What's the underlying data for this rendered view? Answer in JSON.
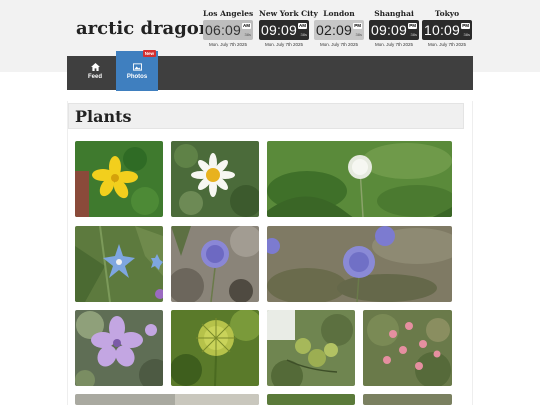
{
  "site": {
    "title": "arctic dragon"
  },
  "clocks": [
    {
      "city": "Los Angeles",
      "time": "06:09",
      "ampm": "AM",
      "seconds": "38s",
      "date": "Mon. July 7th 2025",
      "style": "light"
    },
    {
      "city": "New York City",
      "time": "09:09",
      "ampm": "AM",
      "seconds": "38s",
      "date": "Mon. July 7th 2025",
      "style": "dark"
    },
    {
      "city": "London",
      "time": "02:09",
      "ampm": "PM",
      "seconds": "38s",
      "date": "Mon. July 7th 2025",
      "style": "mid"
    },
    {
      "city": "Shanghai",
      "time": "09:09",
      "ampm": "PM",
      "seconds": "38s",
      "date": "Mon. July 7th 2025",
      "style": "dark"
    },
    {
      "city": "Tokyo",
      "time": "10:09",
      "ampm": "PM",
      "seconds": "38s",
      "date": "Mon. July 7th 2025",
      "style": "dark"
    }
  ],
  "nav": {
    "items": [
      {
        "label": "Feed",
        "icon": "home-icon",
        "active": false
      },
      {
        "label": "Photos",
        "icon": "image-icon",
        "active": true,
        "badge": "New"
      }
    ]
  },
  "section": {
    "title": "Plants"
  },
  "colors": {
    "nav_bg": "#3f3f3f",
    "nav_active": "#3f7fbf",
    "badge": "#d32f2f",
    "header_bg": "#f2f2f2"
  },
  "photos": [
    {
      "subject": "yellow-flower"
    },
    {
      "subject": "white-daisy"
    },
    {
      "subject": "dandelion-seedhead"
    },
    {
      "subject": "blue-star-flower"
    },
    {
      "subject": "purple-globe-flower"
    },
    {
      "subject": "purple-globe-flowers-field"
    },
    {
      "subject": "lilac-flower"
    },
    {
      "subject": "green-spiky-bud"
    },
    {
      "subject": "green-seed-pods"
    },
    {
      "subject": "pink-small-flowers"
    },
    {
      "subject": "partial-photo"
    },
    {
      "subject": "partial-photo"
    },
    {
      "subject": "partial-photo"
    }
  ]
}
